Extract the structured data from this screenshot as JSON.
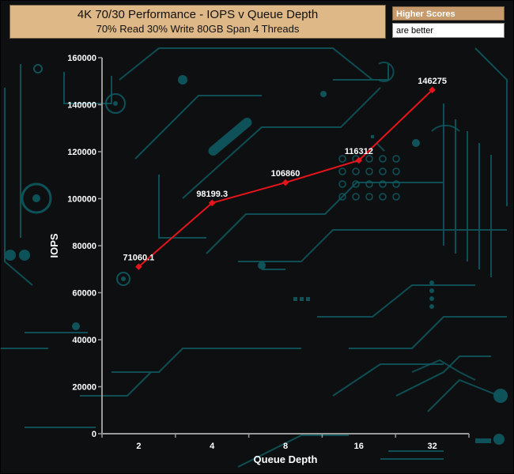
{
  "title": "4K 70/30 Performance - IOPS v Queue Depth",
  "subtitle": "70% Read 30% Write 80GB Span 4 Threads",
  "badge": {
    "top": "Higher Scores",
    "bottom": "are better"
  },
  "colors": {
    "title_bg": "#deb887",
    "badge_bg": "#c79a6c",
    "series": "#e8141c",
    "background": "#0d0f10",
    "circuit": "#0f5a62"
  },
  "chart_data": {
    "type": "line",
    "categories": [
      "2",
      "4",
      "8",
      "16",
      "32"
    ],
    "series": [
      {
        "values": [
          71060.1,
          98199.3,
          106860,
          116312,
          146275
        ]
      }
    ],
    "data_labels": [
      "71060.1",
      "98199.3",
      "106860",
      "116312",
      "146275"
    ],
    "xlabel": "Queue Depth",
    "ylabel": "IOPS",
    "ylim": [
      0,
      160000
    ],
    "yticks": [
      0,
      20000,
      40000,
      60000,
      80000,
      100000,
      120000,
      140000,
      160000
    ],
    "grid": false,
    "legend": "none"
  }
}
